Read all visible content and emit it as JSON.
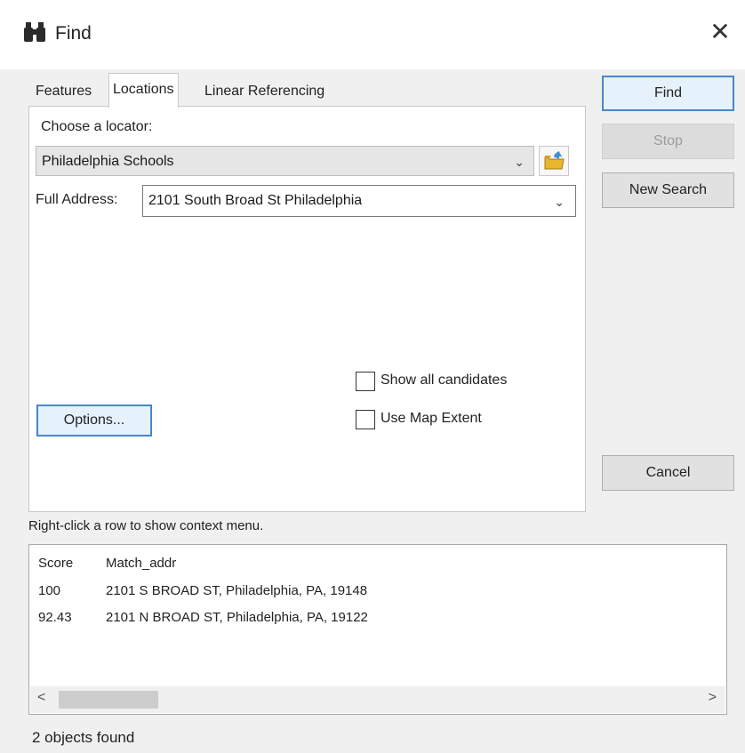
{
  "window": {
    "title": "Find",
    "close_glyph": "✕"
  },
  "tabs": [
    {
      "label": "Features",
      "active": false
    },
    {
      "label": "Locations",
      "active": true
    },
    {
      "label": "Linear Referencing",
      "active": false
    }
  ],
  "locator": {
    "label": "Choose a locator:",
    "value": "Philadelphia Schools"
  },
  "address": {
    "label": "Full Address:",
    "value": "2101 South Broad St Philadelphia"
  },
  "options_button": "Options...",
  "checkboxes": [
    {
      "label": "Show all candidates",
      "checked": false
    },
    {
      "label": "Use Map Extent",
      "checked": false
    }
  ],
  "buttons": {
    "find": "Find",
    "stop": "Stop",
    "new_search": "New Search",
    "cancel": "Cancel"
  },
  "hint": "Right-click a row to show context menu.",
  "results": {
    "columns": [
      "Score",
      "Match_addr"
    ],
    "rows": [
      [
        "100",
        "2101 S BROAD ST, Philadelphia, PA, 19148"
      ],
      [
        "92.43",
        "2101 N BROAD ST, Philadelphia, PA, 19122"
      ]
    ]
  },
  "status": "2 objects found",
  "icons": {
    "title": "binoculars-icon",
    "folder": "open-folder-icon",
    "dropdown": "chevron-down-icon"
  },
  "colors": {
    "accent_border": "#4a86c8",
    "folder": "#e8b62c"
  }
}
